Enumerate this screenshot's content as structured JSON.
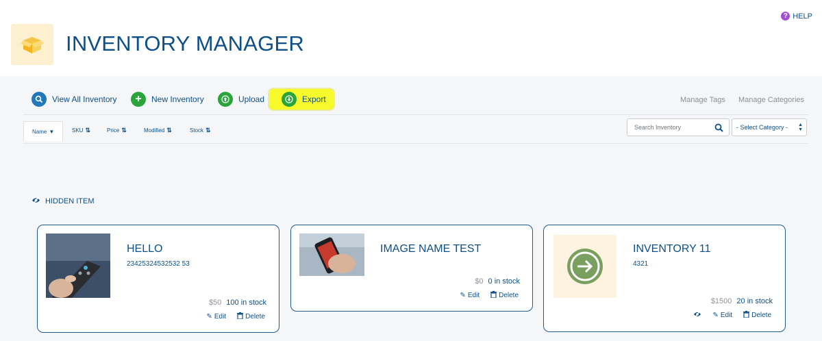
{
  "app": {
    "title": "INVENTORY MANAGER",
    "help_label": "HELP"
  },
  "actions": {
    "view_all": "View All Inventory",
    "new_inventory": "New Inventory",
    "upload": "Upload",
    "export": "Export"
  },
  "links": {
    "manage_tags": "Manage Tags",
    "manage_categories": "Manage Categories"
  },
  "sort": {
    "name": "Name",
    "sku": "SKU",
    "price": "Price",
    "modified": "Modified",
    "stock": "Stock",
    "active": "Name"
  },
  "search": {
    "placeholder": "Search Inventory"
  },
  "category": {
    "selected": "- Select Category -"
  },
  "section": {
    "hidden_item": "HIDDEN ITEM"
  },
  "cards": [
    {
      "name": "HELLO",
      "sku": "23425324532532 53",
      "price": "$50",
      "stock": "100 in stock",
      "edit": "Edit",
      "delete": "Delete"
    },
    {
      "name": "IMAGE NAME TEST",
      "sku": "",
      "price": "$0",
      "stock": "0 in stock",
      "edit": "Edit",
      "delete": "Delete"
    },
    {
      "name": "INVENTORY 11",
      "sku": "4321",
      "price": "$1500",
      "stock": "20 in stock",
      "edit": "Edit",
      "delete": "Delete"
    }
  ],
  "colors": {
    "primary": "#0d4f86",
    "accent_green": "#2aa43b",
    "accent_blue": "#2279b9",
    "highlight": "#f8f92a",
    "help": "#a64fd6"
  }
}
